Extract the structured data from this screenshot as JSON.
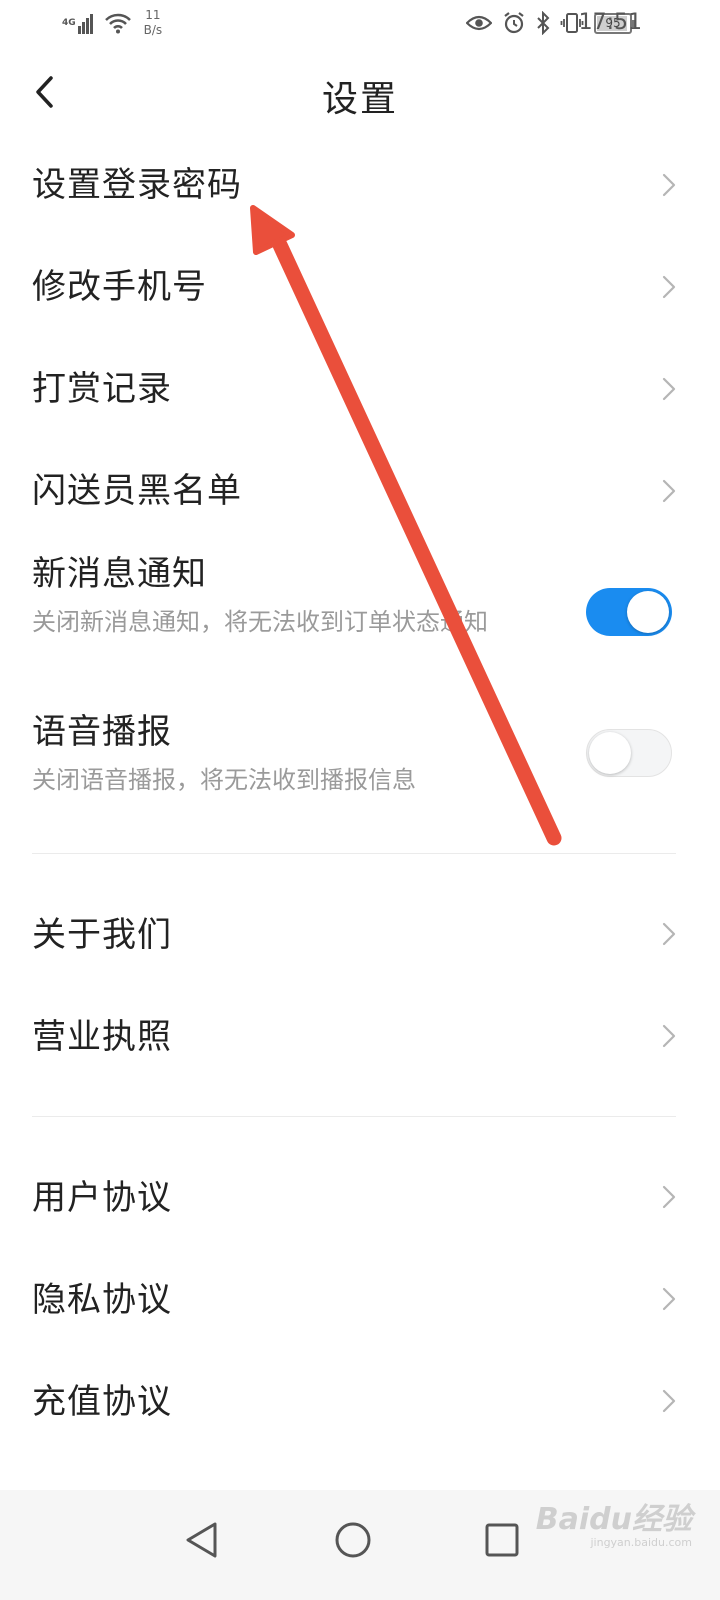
{
  "status_bar": {
    "network": "4G",
    "speed_value": "11",
    "speed_unit": "B/s",
    "battery": "95",
    "time": "17:51"
  },
  "header": {
    "title": "设置"
  },
  "items": {
    "set_login_password": "设置登录密码",
    "change_phone": "修改手机号",
    "tip_records": "打赏记录",
    "courier_blacklist": "闪送员黑名单",
    "new_message_notify": "新消息通知",
    "new_message_notify_desc": "关闭新消息通知，将无法收到订单状态通知",
    "voice_broadcast": "语音播报",
    "voice_broadcast_desc": "关闭语音播报，将无法收到播报信息",
    "about_us": "关于我们",
    "business_license": "营业执照",
    "user_agreement": "用户协议",
    "privacy_agreement": "隐私协议",
    "recharge_agreement": "充值协议"
  },
  "toggles": {
    "new_message_notify_on": true,
    "voice_broadcast_on": false
  },
  "watermark": {
    "main": "Baidu经验",
    "sub": "jingyan.baidu.com"
  },
  "colors": {
    "toggle_on": "#1a8cf0",
    "annotation_arrow": "#ea4f3b"
  },
  "icons": {
    "back": "chevron-left-icon",
    "row_arrow": "chevron-right-icon",
    "nav_back": "triangle-back-icon",
    "nav_home": "circle-home-icon",
    "nav_recent": "square-recent-icon"
  }
}
